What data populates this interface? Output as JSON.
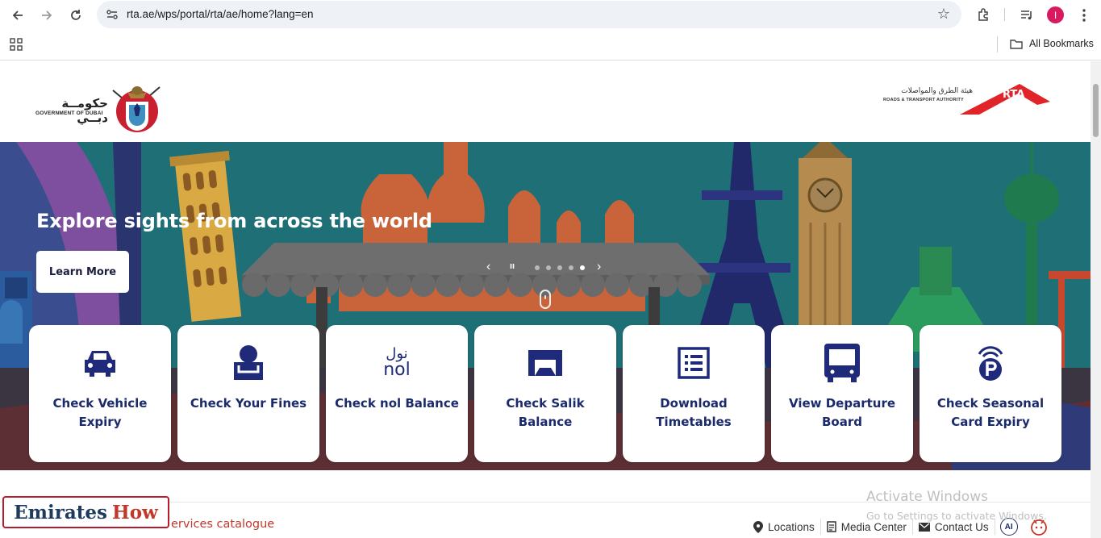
{
  "browser": {
    "url": "rta.ae/wps/portal/rta/ae/home?lang=en",
    "avatar_letter": "I",
    "bookmarks_label": "All Bookmarks"
  },
  "header": {
    "gov_logo_arabic": "حكومــة دبــي",
    "gov_logo_english": "GOVERNMENT OF DUBAI",
    "rta_logo_arabic": "هيئة الطرق والمواصلات",
    "rta_logo_english": "ROADS & TRANSPORT AUTHORITY",
    "rta_logo_text": "RTA"
  },
  "hero": {
    "title": "Explore sights from across the world",
    "cta_label": "Learn More",
    "slide_count": 5,
    "active_slide": 5
  },
  "services": [
    {
      "label": "Check Vehicle Expiry",
      "icon": "car-icon"
    },
    {
      "label": "Check Your Fines",
      "icon": "fines-icon"
    },
    {
      "label": "Check nol Balance",
      "icon": "nol-logo-icon"
    },
    {
      "label": "Check Salik Balance",
      "icon": "salik-gate-icon"
    },
    {
      "label": "Download Timetables",
      "icon": "timetable-icon"
    },
    {
      "label": "View Departure Board",
      "icon": "bus-icon"
    },
    {
      "label": "Check Seasonal Card Expiry",
      "icon": "parking-icon"
    }
  ],
  "nol_logo": {
    "arabic": "نول",
    "latin": "nol"
  },
  "footer": {
    "brand_word1": "Emirates",
    "brand_word2": "How",
    "services_catalogue": "ervices catalogue",
    "quick_links": [
      "Locations",
      "Media Center",
      "Contact Us"
    ],
    "ai_label": "AI"
  },
  "watermark": {
    "line1": "Activate Windows",
    "line2": "Go to Settings to activate Windows."
  },
  "colors": {
    "card_text": "#1b2a6b",
    "icon_navy": "#1f2a7a",
    "rta_red": "#e0242a",
    "hero_bg": "#1f6f76"
  }
}
